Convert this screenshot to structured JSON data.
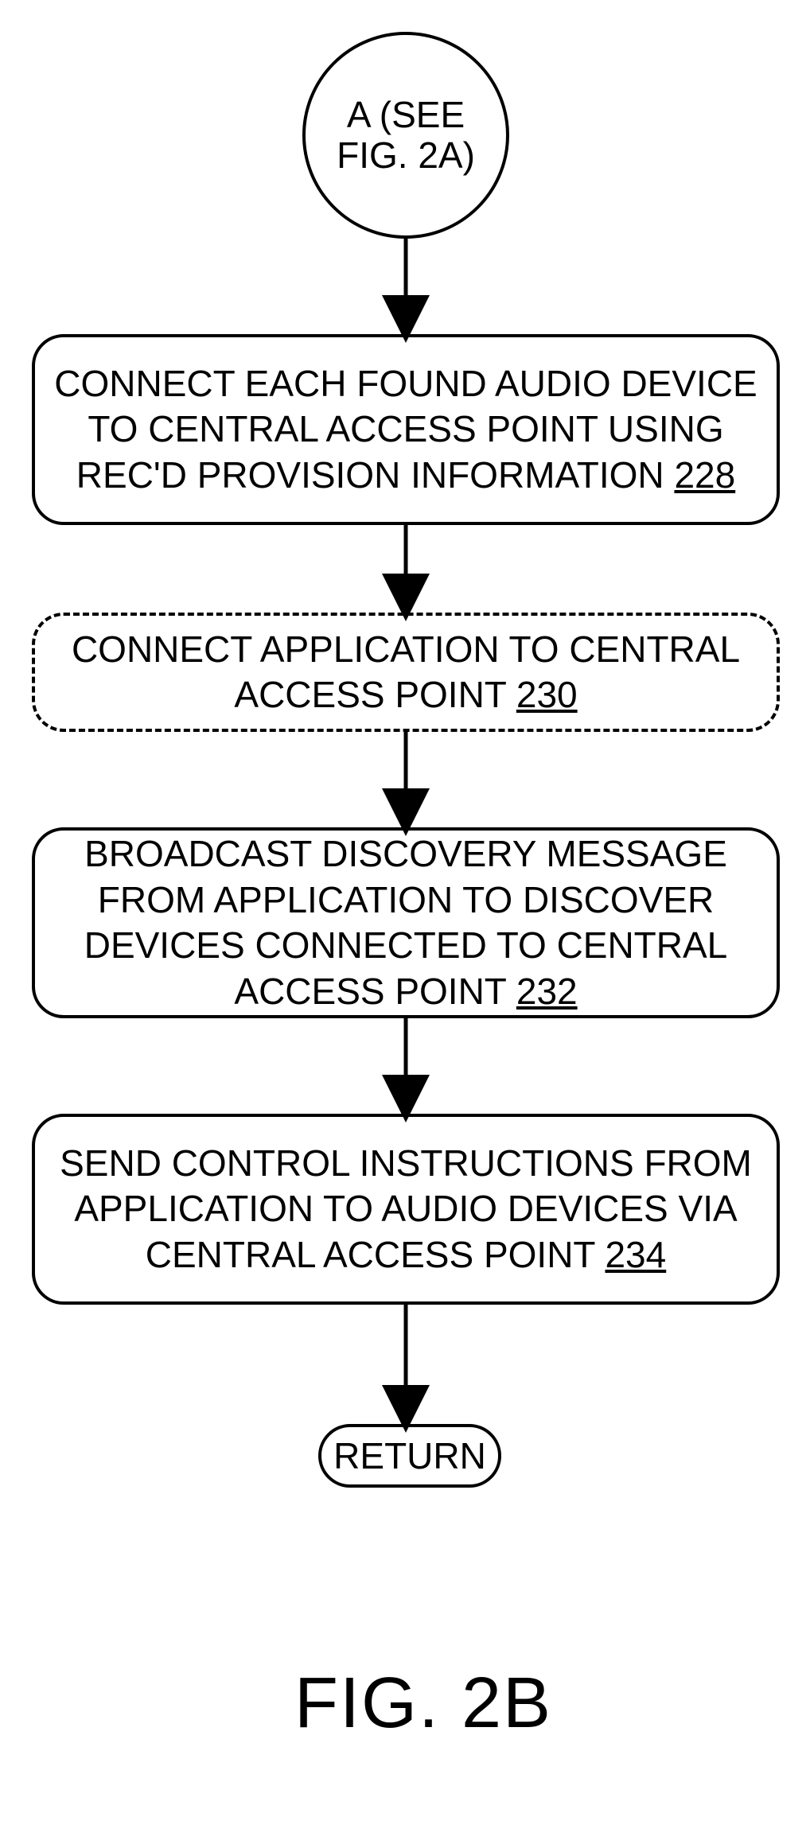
{
  "connector": {
    "label": "A (SEE FIG. 2A)"
  },
  "steps": {
    "s228": {
      "text": "CONNECT EACH FOUND AUDIO DEVICE TO CENTRAL ACCESS POINT USING REC'D PROVISION INFORMATION ",
      "ref": "228"
    },
    "s230": {
      "text": "CONNECT APPLICATION TO CENTRAL ACCESS POINT ",
      "ref": "230"
    },
    "s232": {
      "text": "BROADCAST DISCOVERY MESSAGE FROM APPLICATION TO DISCOVER DEVICES CONNECTED TO CENTRAL ACCESS POINT ",
      "ref": "232"
    },
    "s234": {
      "text": "SEND CONTROL INSTRUCTIONS FROM APPLICATION TO AUDIO DEVICES VIA CENTRAL ACCESS POINT ",
      "ref": "234"
    }
  },
  "terminator": {
    "label": "RETURN"
  },
  "figure_label": "FIG. 2B",
  "chart_data": {
    "type": "flowchart",
    "title": "FIG. 2B",
    "nodes": [
      {
        "id": "A",
        "kind": "off-page-connector",
        "label": "A (SEE FIG. 2A)"
      },
      {
        "id": "228",
        "kind": "process",
        "label": "CONNECT EACH FOUND AUDIO DEVICE TO CENTRAL ACCESS POINT USING REC'D PROVISION INFORMATION 228"
      },
      {
        "id": "230",
        "kind": "process-optional",
        "label": "CONNECT APPLICATION TO CENTRAL ACCESS POINT 230",
        "style": "dashed"
      },
      {
        "id": "232",
        "kind": "process",
        "label": "BROADCAST DISCOVERY MESSAGE FROM APPLICATION TO DISCOVER DEVICES CONNECTED TO CENTRAL ACCESS POINT 232"
      },
      {
        "id": "234",
        "kind": "process",
        "label": "SEND CONTROL INSTRUCTIONS FROM APPLICATION TO AUDIO DEVICES VIA CENTRAL ACCESS POINT 234"
      },
      {
        "id": "RET",
        "kind": "terminator",
        "label": "RETURN"
      }
    ],
    "edges": [
      {
        "from": "A",
        "to": "228"
      },
      {
        "from": "228",
        "to": "230"
      },
      {
        "from": "230",
        "to": "232"
      },
      {
        "from": "232",
        "to": "234"
      },
      {
        "from": "234",
        "to": "RET"
      }
    ]
  }
}
